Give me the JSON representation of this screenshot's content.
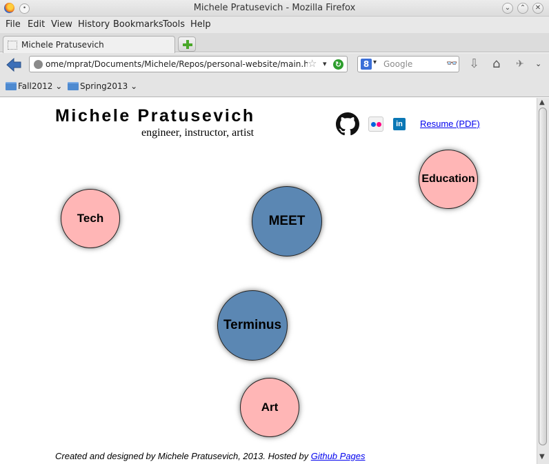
{
  "window": {
    "title": "Michele Pratusevich - Mozilla Firefox"
  },
  "menu": [
    "File",
    "Edit",
    "View",
    "History",
    "Bookmarks",
    "Tools",
    "Help"
  ],
  "tab": {
    "label": "Michele Pratusevich"
  },
  "nav": {
    "url": "ome/mprat/Documents/Michele/Repos/personal-website/main.html",
    "search_engine_letter": "8",
    "search_placeholder": "Google"
  },
  "bookmarks": [
    "Fall2012",
    "Spring2013"
  ],
  "page": {
    "name": "Michele Pratusevich",
    "tagline": "engineer, instructor, artist",
    "resume_label": "Resume (PDF)",
    "social_icons": [
      "github-icon",
      "flickr-icon",
      "linkedin-icon"
    ],
    "linkedin_text": "in",
    "bubbles": [
      {
        "label": "Tech",
        "color": "#ffb6b6"
      },
      {
        "label": "MEET",
        "color": "#5b87b3"
      },
      {
        "label": "Education",
        "color": "#ffb6b6"
      },
      {
        "label": "Terminus",
        "color": "#5b87b3"
      },
      {
        "label": "Art",
        "color": "#ffb6b6"
      }
    ],
    "footer": {
      "text": "Created and designed by Michele Pratusevich, 2013. Hosted by ",
      "link": "Github Pages"
    }
  }
}
